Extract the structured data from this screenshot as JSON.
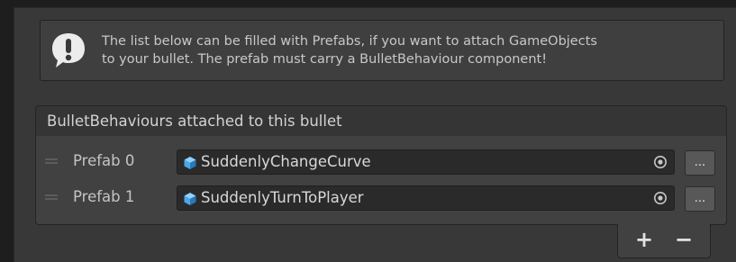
{
  "helpbox": {
    "icon": "info-exclamation-icon",
    "line1": "The list below can be filled with Prefabs, if you want to attach GameObjects",
    "line2": "to your bullet. The prefab must carry a BulletBehaviour component!"
  },
  "list": {
    "title": "BulletBehaviours attached to this bullet",
    "items": [
      {
        "label": "Prefab 0",
        "value": "SuddenlyChangeCurve",
        "icon": "prefab-cube-icon",
        "button": "..."
      },
      {
        "label": "Prefab 1",
        "value": "SuddenlyTurnToPlayer",
        "icon": "prefab-cube-icon",
        "button": "..."
      }
    ],
    "add_label": "+",
    "remove_label": "−"
  },
  "colors": {
    "background": "#383838",
    "field": "#2a2a2a",
    "prefab_icon": "#4aa8e8"
  }
}
